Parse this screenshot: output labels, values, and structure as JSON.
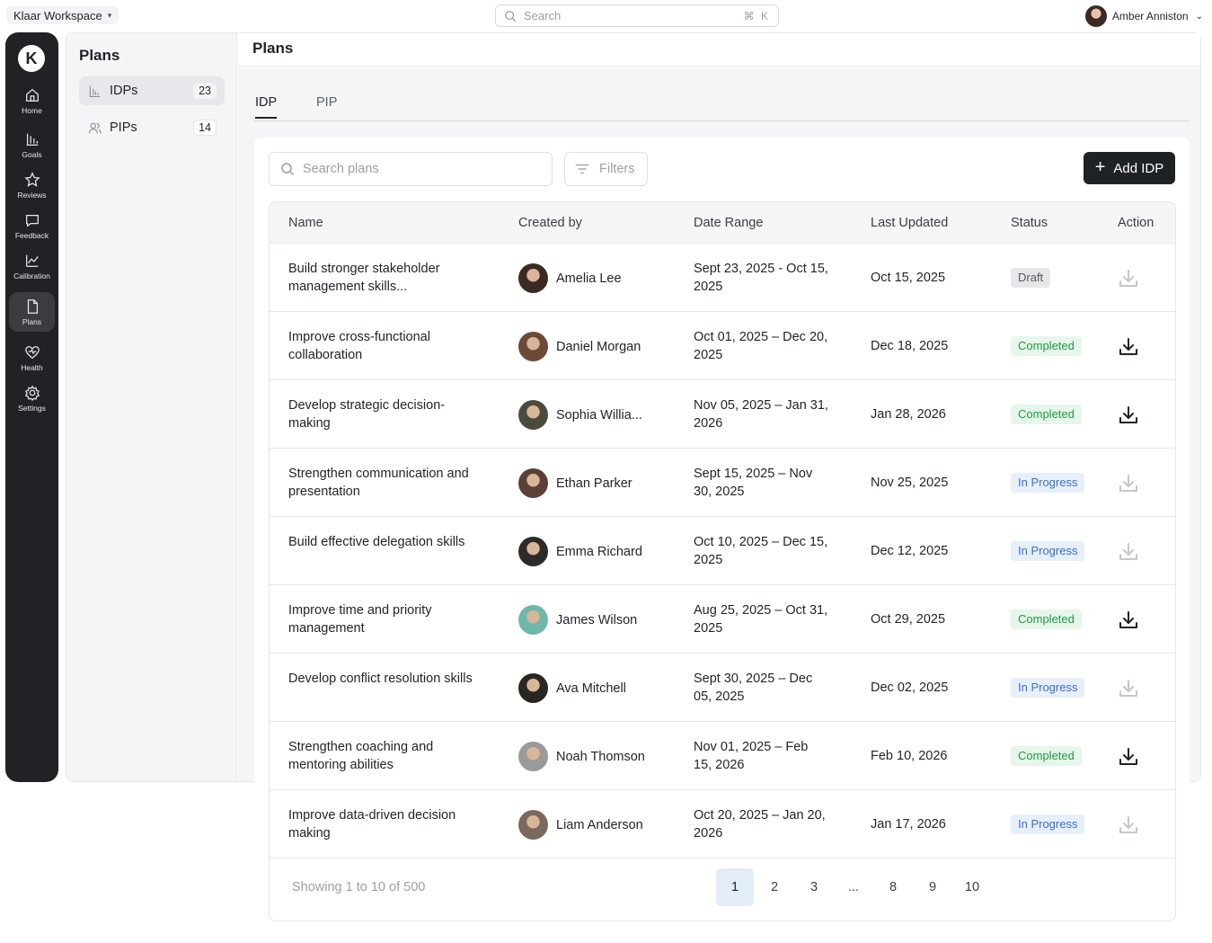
{
  "topbar": {
    "workspace": "Klaar Workspace",
    "search_placeholder": "Search",
    "shortcut": "⌘ K",
    "user_name": "Amber Anniston"
  },
  "rail": {
    "logo": "K",
    "items": [
      {
        "label": "Home",
        "icon": "home-icon"
      },
      {
        "label": "Goals",
        "icon": "bar-chart-icon"
      },
      {
        "label": "Reviews",
        "icon": "star-icon"
      },
      {
        "label": "Feedback",
        "icon": "chat-bubble-icon"
      },
      {
        "label": "Calibration",
        "icon": "line-chart-icon"
      },
      {
        "label": "Plans",
        "icon": "document-icon"
      },
      {
        "label": "Health",
        "icon": "heart-pulse-icon"
      },
      {
        "label": "Settings",
        "icon": "gear-icon"
      }
    ]
  },
  "subnav": {
    "title": "Plans",
    "items": [
      {
        "label": "IDPs",
        "count": "23"
      },
      {
        "label": "PIPs",
        "count": "14"
      }
    ]
  },
  "main": {
    "title": "Plans",
    "tabs": [
      {
        "label": "IDP"
      },
      {
        "label": "PIP"
      }
    ],
    "search_placeholder": "Search plans",
    "filters_label": "Filters",
    "add_label": "Add IDP"
  },
  "table": {
    "headers": [
      "Name",
      "Created by",
      "Date Range",
      "Last Updated",
      "Status",
      "Action"
    ],
    "rows": [
      {
        "name": "Build stronger stakeholder management skills...",
        "creator": "Amelia Lee",
        "range": "Sept 23, 2025 - Oct 15, 2025",
        "updated": "Oct 15, 2025",
        "status": "Draft",
        "status_kind": "draft",
        "download_enabled": false,
        "avatar_color": "#3b2a22"
      },
      {
        "name": "Improve cross-functional collaboration",
        "creator": "Daniel Morgan",
        "range": "Oct 01, 2025 – Dec 20, 2025",
        "updated": "Dec 18, 2025",
        "status": "Completed",
        "status_kind": "completed",
        "download_enabled": true,
        "avatar_color": "#6b4a3a"
      },
      {
        "name": "Develop strategic decision-making",
        "creator": "Sophia Willia...",
        "range": "Nov 05, 2025 – Jan 31, 2026",
        "updated": "Jan 28, 2026",
        "status": "Completed",
        "status_kind": "completed",
        "download_enabled": true,
        "avatar_color": "#4a4a3e"
      },
      {
        "name": "Strengthen communication and presentation",
        "creator": "Ethan Parker",
        "range": "Sept 15, 2025 – Nov 30, 2025",
        "updated": "Nov 25, 2025",
        "status": "In Progress",
        "status_kind": "progress",
        "download_enabled": false,
        "avatar_color": "#5a4036"
      },
      {
        "name": "Build effective delegation skills",
        "creator": "Emma Richard",
        "range": "Oct 10, 2025 – Dec 15, 2025",
        "updated": "Dec 12, 2025",
        "status": "In Progress",
        "status_kind": "progress",
        "download_enabled": false,
        "avatar_color": "#2e2a28"
      },
      {
        "name": "Improve time and priority management",
        "creator": "James Wilson",
        "range": "Aug 25, 2025 – Oct 31, 2025",
        "updated": "Oct 29, 2025",
        "status": "Completed",
        "status_kind": "completed",
        "download_enabled": true,
        "avatar_color": "#6fb7a8"
      },
      {
        "name": "Develop conflict resolution skills",
        "creator": "Ava Mitchell",
        "range": "Sept 30, 2025 – Dec 05, 2025",
        "updated": "Dec 02, 2025",
        "status": "In Progress",
        "status_kind": "progress",
        "download_enabled": false,
        "avatar_color": "#2a2624"
      },
      {
        "name": "Strengthen coaching and mentoring abilities",
        "creator": "Noah Thomson",
        "range": "Nov 01, 2025 – Feb 15, 2026",
        "updated": "Feb 10, 2026",
        "status": "Completed",
        "status_kind": "completed",
        "download_enabled": true,
        "avatar_color": "#9a9a9a"
      },
      {
        "name": "Improve data-driven decision making",
        "creator": "Liam Anderson",
        "range": "Oct 20, 2025 – Jan 20, 2026",
        "updated": "Jan 17, 2026",
        "status": "In Progress",
        "status_kind": "progress",
        "download_enabled": false,
        "avatar_color": "#7a6a5e"
      }
    ]
  },
  "pagination": {
    "showing": "Showing 1 to 10 of 500",
    "pages": [
      "1",
      "2",
      "3",
      "...",
      "8",
      "9",
      "10"
    ],
    "active": "1"
  },
  "colors": {
    "rail_bg": "#202225",
    "primary_button": "#1f2225",
    "completed": "#1f9a44",
    "in_progress": "#3a6fd0",
    "draft": "#55595f"
  }
}
